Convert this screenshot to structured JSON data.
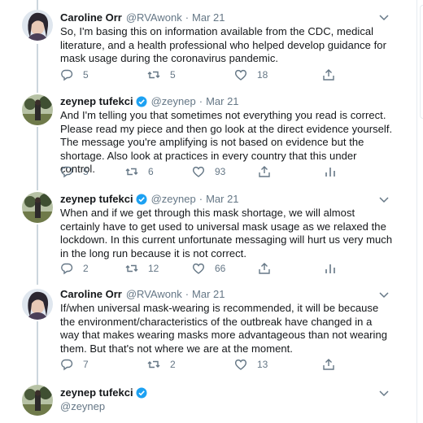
{
  "tweets": [
    {
      "name": "Caroline Orr",
      "handle": "@RVAwonk",
      "dot": "·",
      "time": "Mar 21",
      "verified": false,
      "text": "So, I'm basing this on information available from the CDC, medical literature, and a health professional who helped develop guidance for mask usage during the coronavirus pandemic.",
      "replies": "5",
      "retweets": "5",
      "likes": "18",
      "has_analytics": false
    },
    {
      "name": "zeynep tufekci",
      "handle": "@zeynep",
      "dot": "·",
      "time": "Mar 21",
      "verified": true,
      "text": "And I'm telling you that sometimes not everything you read is correct. Please read my piece and then go look at the direct evidence yourself. The message you're amplifying is not based on evidence but the shortage. Also look at practices in every country that this under control.",
      "replies": "5",
      "retweets": "6",
      "likes": "93",
      "has_analytics": true
    },
    {
      "name": "zeynep tufekci",
      "handle": "@zeynep",
      "dot": "·",
      "time": "Mar 21",
      "verified": true,
      "text": "When and if we get through this mask shortage, we will almost certainly have to get used to universal mask usage as we relaxed the lockdown. In this current unfortunate messaging will hurt us very much in the long run because it is not correct.",
      "replies": "2",
      "retweets": "12",
      "likes": "66",
      "has_analytics": true
    },
    {
      "name": "Caroline Orr",
      "handle": "@RVAwonk",
      "dot": "·",
      "time": "Mar 21",
      "verified": false,
      "text": "If/when universal mask-wearing is recommended, it will be because the environment/characteristics of the outbreak have changed in a way that makes wearing masks more advantageous than not wearing them. But that's not where we are at the moment.",
      "replies": "7",
      "retweets": "2",
      "likes": "13",
      "has_analytics": false
    }
  ],
  "last_tweet": {
    "name": "zeynep tufekci",
    "handle": "@zeynep",
    "verified": true
  },
  "colors": {
    "text": "#14171a",
    "secondary": "#657786",
    "verified": "#1da1f2",
    "thread_line": "#ccd6dd"
  },
  "icons": [
    "reply-icon",
    "retweet-icon",
    "like-icon",
    "share-icon",
    "analytics-icon",
    "verified-badge-icon",
    "chevron-down-icon"
  ]
}
